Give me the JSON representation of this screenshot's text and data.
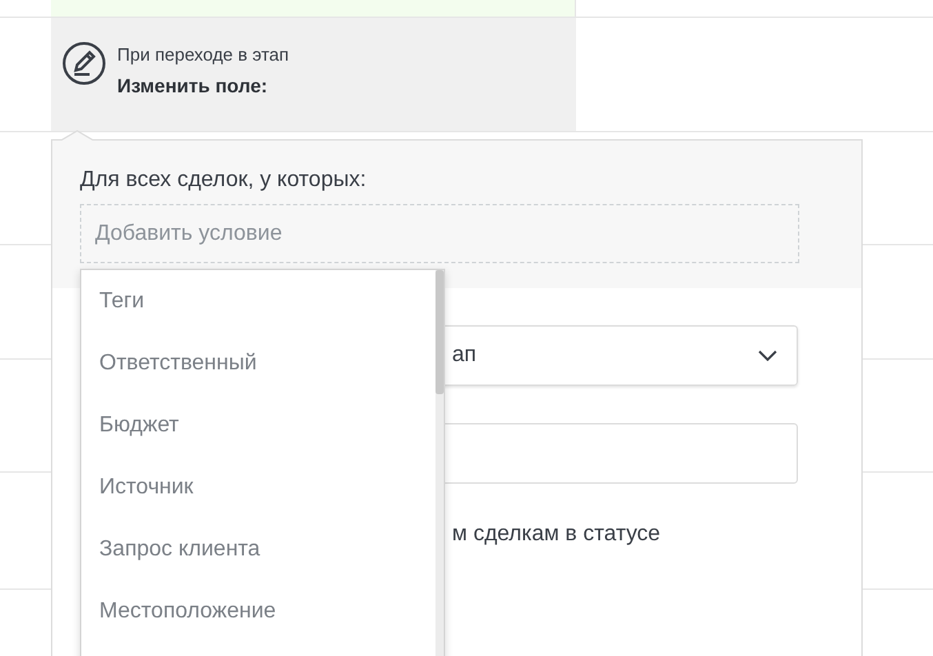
{
  "trigger": {
    "label": "При переходе в этап",
    "title": "Изменить поле:"
  },
  "popup": {
    "condition_label": "Для всех сделок, у которых:",
    "condition_field": {
      "placeholder": "Добавить условие"
    },
    "select": {
      "value": "ап"
    },
    "apply_text": "м сделкам в статусе"
  },
  "dropdown": {
    "items": [
      {
        "label": "Теги"
      },
      {
        "label": "Ответственный"
      },
      {
        "label": "Бюджет"
      },
      {
        "label": "Источник"
      },
      {
        "label": "Запрос клиента"
      },
      {
        "label": "Местоположение"
      }
    ]
  }
}
